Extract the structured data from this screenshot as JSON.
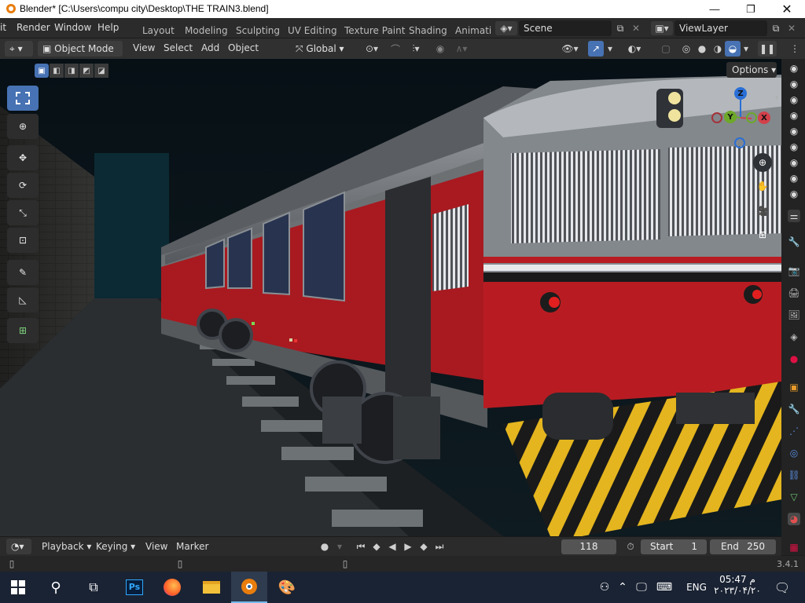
{
  "window": {
    "title": "Blender* [C:\\Users\\compu city\\Desktop\\THE TRAIN3.blend]"
  },
  "menu": [
    "it",
    "Render",
    "Window",
    "Help"
  ],
  "workspaces": [
    "Layout",
    "Modeling",
    "Sculpting",
    "UV Editing",
    "Texture Paint",
    "Shading",
    "Animati"
  ],
  "scene": "Scene",
  "view_layer": "ViewLayer",
  "header": {
    "mode": "Object Mode",
    "view": "View",
    "select": "Select",
    "add": "Add",
    "object": "Object",
    "orientation": "Global"
  },
  "options_label": "Options",
  "gizmo": {
    "z": "Z",
    "y": "Y",
    "x": "X"
  },
  "timeline": {
    "playback": "Playback",
    "keying": "Keying",
    "view": "View",
    "marker": "Marker",
    "current_frame": "118",
    "start_label": "Start",
    "start": "1",
    "end_label": "End",
    "end": "250"
  },
  "version": "3.4.1",
  "clock": {
    "time": "05:47 م",
    "date": "۲۰۲۳/۰۴/۲۰"
  },
  "lang": "ENG",
  "colors": {
    "accent": "#4772b3",
    "train_red": "#b81c22",
    "stripe_yellow": "#e4b51e"
  }
}
